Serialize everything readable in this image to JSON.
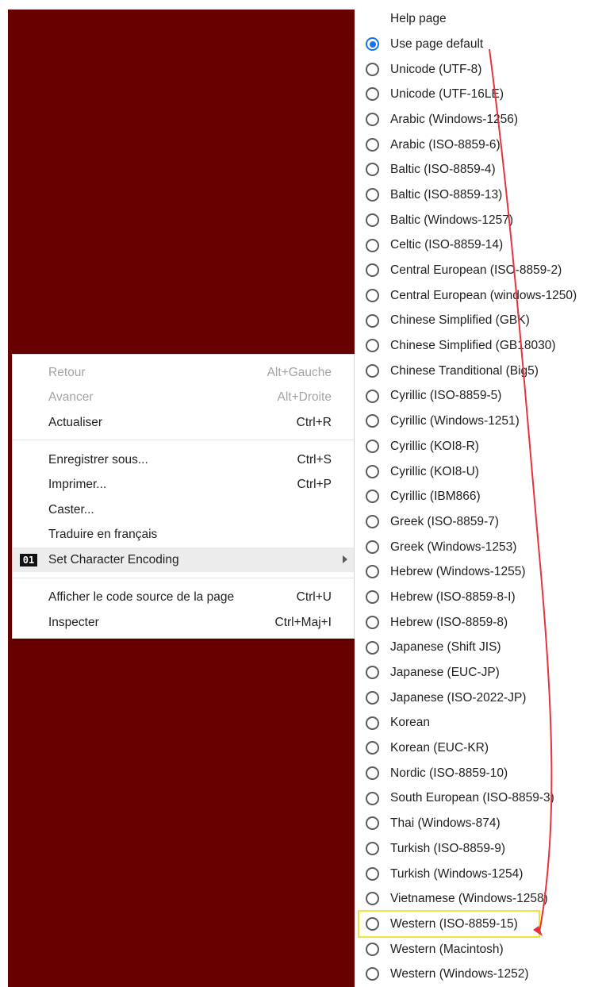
{
  "background_color": "#680000",
  "accent_color": "#1a73e8",
  "annotation_arrow_color": "#e8323c",
  "highlight_box_color": "#f4e23a",
  "context_menu": {
    "items": [
      {
        "label": "Retour",
        "shortcut": "Alt+Gauche",
        "disabled": true
      },
      {
        "label": "Avancer",
        "shortcut": "Alt+Droite",
        "disabled": true
      },
      {
        "label": "Actualiser",
        "shortcut": "Ctrl+R",
        "disabled": false
      },
      {
        "label": "Enregistrer sous...",
        "shortcut": "Ctrl+S",
        "disabled": false
      },
      {
        "label": "Imprimer...",
        "shortcut": "Ctrl+P",
        "disabled": false
      },
      {
        "label": "Caster...",
        "shortcut": "",
        "disabled": false
      },
      {
        "label": "Traduire en français",
        "shortcut": "",
        "disabled": false
      },
      {
        "label": "Set Character Encoding",
        "shortcut": "",
        "badge": "01",
        "has_submenu": true,
        "highlighted": true
      },
      {
        "label": "Afficher le code source de la page",
        "shortcut": "Ctrl+U",
        "disabled": false
      },
      {
        "label": "Inspecter",
        "shortcut": "Ctrl+Maj+I",
        "disabled": false
      }
    ]
  },
  "encoding_menu": {
    "header": "Help page",
    "selected": "Use page default",
    "highlighted_item": "Western (ISO-8859-15)",
    "items": [
      "Use page default",
      "Unicode (UTF-8)",
      "Unicode (UTF-16LE)",
      "Arabic (Windows-1256)",
      "Arabic (ISO-8859-6)",
      "Baltic (ISO-8859-4)",
      "Baltic (ISO-8859-13)",
      "Baltic (Windows-1257)",
      "Celtic (ISO-8859-14)",
      "Central European (ISO-8859-2)",
      "Central European (windows-1250)",
      "Chinese Simplified (GBK)",
      "Chinese Simplified (GB18030)",
      "Chinese Tranditional (Big5)",
      "Cyrillic (ISO-8859-5)",
      "Cyrillic (Windows-1251)",
      "Cyrillic (KOI8-R)",
      "Cyrillic (KOI8-U)",
      "Cyrillic (IBM866)",
      "Greek (ISO-8859-7)",
      "Greek (Windows-1253)",
      "Hebrew (Windows-1255)",
      "Hebrew (ISO-8859-8-I)",
      "Hebrew (ISO-8859-8)",
      "Japanese (Shift JIS)",
      "Japanese (EUC-JP)",
      "Japanese (ISO-2022-JP)",
      "Korean",
      "Korean (EUC-KR)",
      "Nordic (ISO-8859-10)",
      "South European (ISO-8859-3)",
      "Thai (Windows-874)",
      "Turkish (ISO-8859-9)",
      "Turkish (Windows-1254)",
      "Vietnamese (Windows-1258)",
      "Western (ISO-8859-15)",
      "Western (Macintosh)",
      "Western (Windows-1252)"
    ]
  }
}
